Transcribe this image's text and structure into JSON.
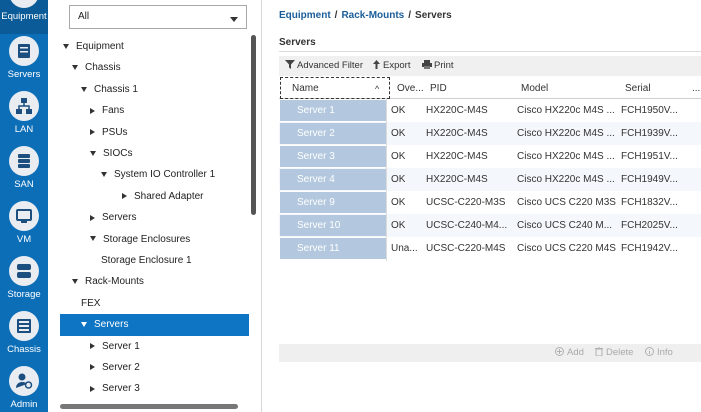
{
  "nav": [
    {
      "id": "equipment",
      "label": "Equipment",
      "icon": "equipment-icon",
      "active": true
    },
    {
      "id": "servers",
      "label": "Servers",
      "icon": "servers-icon",
      "active": false
    },
    {
      "id": "lan",
      "label": "LAN",
      "icon": "lan-icon",
      "active": false
    },
    {
      "id": "san",
      "label": "SAN",
      "icon": "san-icon",
      "active": false
    },
    {
      "id": "vm",
      "label": "VM",
      "icon": "vm-icon",
      "active": false
    },
    {
      "id": "storage",
      "label": "Storage",
      "icon": "storage-icon",
      "active": false
    },
    {
      "id": "chassis",
      "label": "Chassis",
      "icon": "chassis-icon",
      "active": false
    },
    {
      "id": "admin",
      "label": "Admin",
      "icon": "admin-icon",
      "active": false
    }
  ],
  "tree": {
    "filter_value": "All",
    "items": [
      {
        "label": "Equipment",
        "level": 0,
        "expander": "down",
        "selected": false
      },
      {
        "label": "Chassis",
        "level": 1,
        "expander": "down",
        "selected": false
      },
      {
        "label": "Chassis 1",
        "level": 2,
        "expander": "down",
        "selected": false
      },
      {
        "label": "Fans",
        "level": 3,
        "expander": "right",
        "selected": false
      },
      {
        "label": "PSUs",
        "level": 3,
        "expander": "right",
        "selected": false
      },
      {
        "label": "SIOCs",
        "level": 3,
        "expander": "down",
        "selected": false
      },
      {
        "label": "System IO Controller 1",
        "level": 4,
        "expander": "down",
        "selected": false
      },
      {
        "label": "Shared Adapter",
        "level": 5,
        "expander": "right",
        "selected": false
      },
      {
        "label": "Servers",
        "level": 3,
        "expander": "right",
        "selected": false
      },
      {
        "label": "Storage Enclosures",
        "level": 3,
        "expander": "down",
        "selected": false
      },
      {
        "label": "Storage Enclosure 1",
        "level": 4,
        "expander": "none",
        "selected": false
      },
      {
        "label": "Rack-Mounts",
        "level": 1,
        "expander": "down",
        "selected": false
      },
      {
        "label": "FEX",
        "level": 2,
        "expander": "none",
        "selected": false
      },
      {
        "label": "Servers",
        "level": 2,
        "expander": "down",
        "selected": true
      },
      {
        "label": "Server 1",
        "level": 3,
        "expander": "right",
        "selected": false
      },
      {
        "label": "Server 2",
        "level": 3,
        "expander": "right",
        "selected": false
      },
      {
        "label": "Server 3",
        "level": 3,
        "expander": "right",
        "selected": false
      }
    ]
  },
  "breadcrumb": [
    "Equipment",
    "Rack-Mounts",
    "Servers"
  ],
  "breadcrumb_sep": "/",
  "section_title": "Servers",
  "toolbar": {
    "advanced_filter": "Advanced Filter",
    "export": "Export",
    "print": "Print"
  },
  "table": {
    "columns": [
      "Name",
      "Ove...",
      "PID",
      "Model",
      "Serial",
      "..."
    ],
    "sort_indicator": "^",
    "rows": [
      [
        "Server 1",
        "OK",
        "HX220C-M4S",
        "Cisco HX220c M4S ...",
        "FCH1950V..."
      ],
      [
        "Server 2",
        "OK",
        "HX220C-M4S",
        "Cisco HX220c M4S ...",
        "FCH1939V..."
      ],
      [
        "Server 3",
        "OK",
        "HX220C-M4S",
        "Cisco HX220c M4S ...",
        "FCH1951V..."
      ],
      [
        "Server 4",
        "OK",
        "HX220C-M4S",
        "Cisco HX220c M4S ...",
        "FCH1949V..."
      ],
      [
        "Server 9",
        "OK",
        "UCSC-C220-M3S",
        "Cisco UCS C220 M3S",
        "FCH1832V..."
      ],
      [
        "Server 10",
        "OK",
        "UCSC-C240-M4...",
        "Cisco UCS C240 M...",
        "FCH2025V..."
      ],
      [
        "Server 11",
        "Una...",
        "UCSC-C220-M4S",
        "Cisco UCS C220 M4S",
        "FCH1942V..."
      ]
    ]
  },
  "bottom_bar": {
    "add": "Add",
    "delete": "Delete",
    "info": "Info"
  },
  "colors": {
    "nav_bg": "#0d6eb8",
    "tree_selected": "#0e74c4",
    "name_cell": "#b3c8de",
    "breadcrumb_link": "#1b5d99"
  }
}
